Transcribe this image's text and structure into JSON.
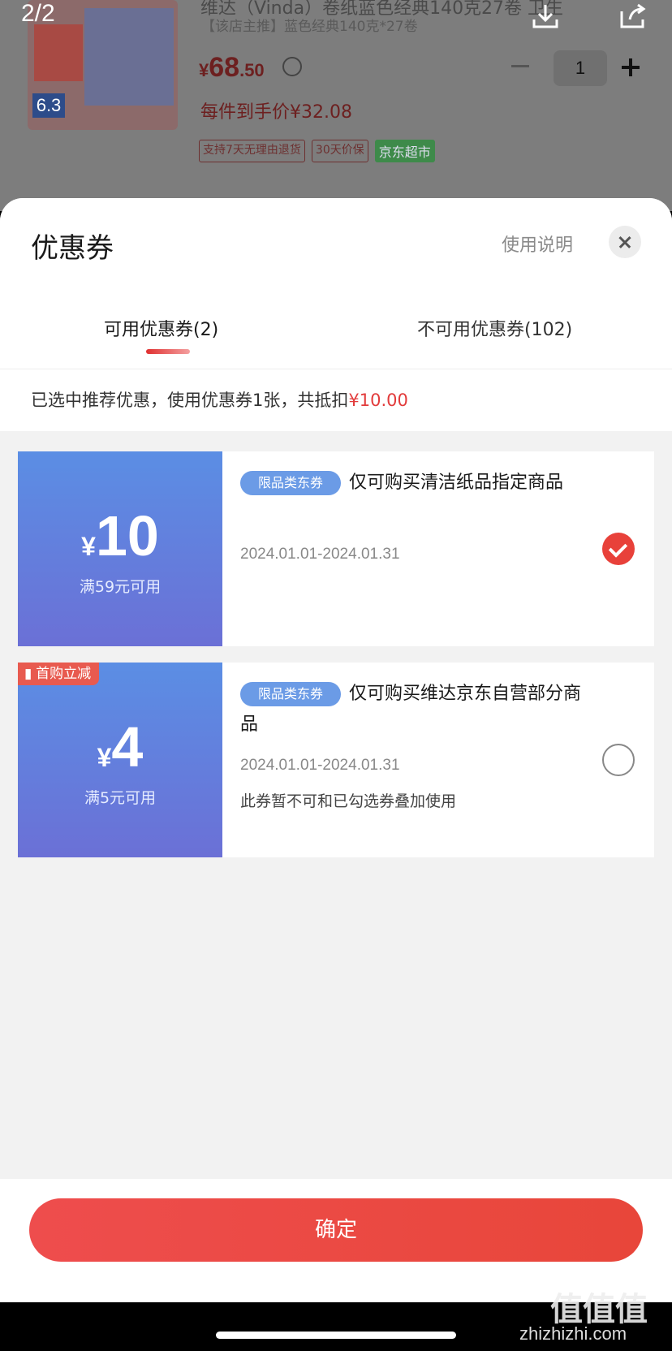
{
  "viewer": {
    "counter": "2/2"
  },
  "product": {
    "title": "维达（Vinda）卷纸蓝色经典140克27卷 卫生",
    "subtitle": "【该店主推】蓝色经典140克*27卷",
    "price_symbol": "¥",
    "price_int": "68",
    "price_dec": ".50",
    "quantity": "1",
    "per_item_price": "每件到手价¥32.08",
    "image_label": "6.3",
    "tags": [
      "支持7天无理由退货",
      "30天价保",
      "京东超市"
    ]
  },
  "sheet": {
    "title": "优惠券",
    "help_link": "使用说明",
    "tabs": [
      {
        "label": "可用优惠券(2)",
        "active": true
      },
      {
        "label": "不可用优惠券(102)",
        "active": false
      }
    ],
    "summary_prefix": "已选中推荐优惠，使用优惠券1张，共抵扣",
    "summary_amount": "¥10.00"
  },
  "coupons": [
    {
      "currency": "¥",
      "amount": "10",
      "condition": "满59元可用",
      "badge": "限品类东券",
      "description": "仅可购买清洁纸品指定商品",
      "description_cont": "",
      "date_range": "2024.01.01-2024.01.31",
      "note": "",
      "ribbon": "",
      "selected": true
    },
    {
      "currency": "¥",
      "amount": "4",
      "condition": "满5元可用",
      "badge": "限品类东券",
      "description": "仅可购买维达京东自营部分商",
      "description_cont": "品",
      "date_range": "2024.01.01-2024.01.31",
      "note": "此券暂不可和已勾选券叠加使用",
      "ribbon": "首购立减",
      "selected": false
    }
  ],
  "footer": {
    "confirm_label": "确定"
  },
  "watermark": {
    "logo": "值值值",
    "url": "zhizhizhi.com"
  },
  "colors": {
    "accent_red": "#e8413a",
    "coupon_blue": "#5b8ee4",
    "badge_blue": "#6b9be6"
  }
}
